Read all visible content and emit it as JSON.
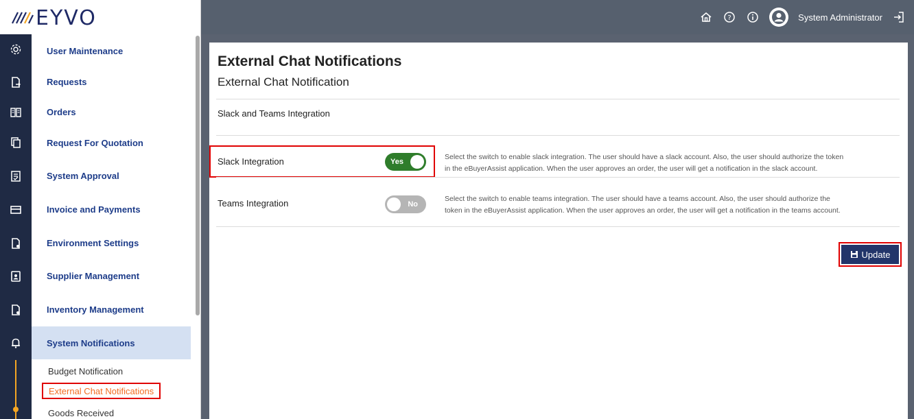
{
  "brand": {
    "logo_text": "EYVO"
  },
  "header": {
    "user_name": "System Administrator",
    "icons": [
      "home-icon",
      "help-icon",
      "info-icon",
      "user-avatar-icon",
      "logout-icon"
    ]
  },
  "sidebar": {
    "items": [
      {
        "label": "User Maintenance",
        "icon": "gear-icon"
      },
      {
        "label": "Requests",
        "icon": "document-arrow-icon"
      },
      {
        "label": "Orders",
        "icon": "book-icon"
      },
      {
        "label": "Request For Quotation",
        "icon": "copy-document-icon"
      },
      {
        "label": "System Approval",
        "icon": "checklist-icon"
      },
      {
        "label": "Invoice and Payments",
        "icon": "invoice-icon"
      },
      {
        "label": "Environment Settings",
        "icon": "document-gear-icon"
      },
      {
        "label": "Supplier Management",
        "icon": "document-person-icon"
      },
      {
        "label": "Inventory Management",
        "icon": "document-gear-icon"
      },
      {
        "label": "System Notifications",
        "icon": "bell-icon"
      }
    ],
    "sub_items": [
      {
        "label": "Budget Notification"
      },
      {
        "label": "External Chat Notifications"
      },
      {
        "label": "Goods Received"
      }
    ]
  },
  "main": {
    "title": "External Chat Notifications",
    "subtitle": "External Chat Notification",
    "section": "Slack and Teams Integration",
    "rows": [
      {
        "label": "Slack Integration",
        "toggle": "Yes",
        "desc_line1": "Select the switch to enable slack integration. The user should have a slack account. Also, the user should authorize the token",
        "desc_line2": "in the eBuyerAssist application. When the user approves an order, the user will get a notification in the slack account."
      },
      {
        "label": "Teams Integration",
        "toggle": "No",
        "desc_line1": "Select the switch to enable teams integration. The user should have a teams account. Also, the user should authorize the",
        "desc_line2": "token in the eBuyerAssist application. When the user approves an order, the user will get a notification in the teams account."
      }
    ],
    "update_label": "Update"
  },
  "colors": {
    "accent": "#1d3c89",
    "toggle_on": "#2f7d2b",
    "toggle_off": "#b5b5b5",
    "button": "#22356a",
    "active_sub": "#f36c21",
    "highlight": "#e00000"
  }
}
